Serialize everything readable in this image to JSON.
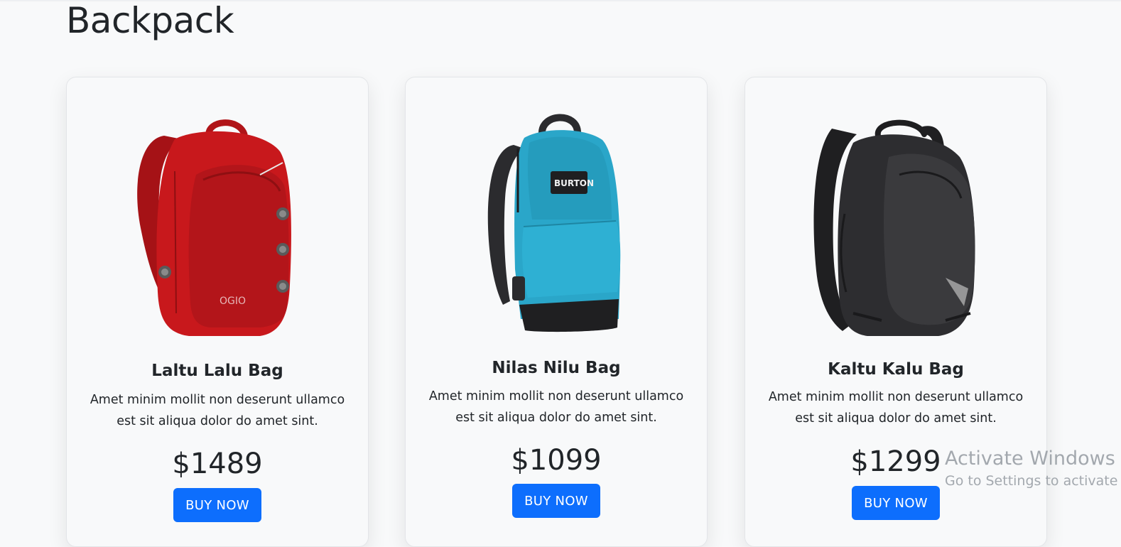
{
  "section": {
    "title": "Backpack"
  },
  "products": [
    {
      "name": "Laltu Lalu Bag",
      "description": "Amet minim mollit non deserunt ullamco est sit aliqua dolor do amet sint.",
      "price": "$1489",
      "button_label": "BUY NOW",
      "image_icon": "red-backpack-image",
      "brand_text": "OGIO",
      "color": "#c0161a"
    },
    {
      "name": "Nilas Nilu Bag",
      "description": "Amet minim mollit non deserunt ullamco est sit aliqua dolor do amet sint.",
      "price": "$1099",
      "button_label": "BUY NOW",
      "image_icon": "blue-backpack-image",
      "brand_text": "BURTON",
      "color": "#2aa6c9"
    },
    {
      "name": "Kaltu Kalu Bag",
      "description": "Amet minim mollit non deserunt ullamco est sit aliqua dolor do amet sint.",
      "price": "$1299",
      "button_label": "BUY NOW",
      "image_icon": "black-backpack-image",
      "color": "#2a2a2c"
    }
  ],
  "watermark": {
    "title": "Activate Windows",
    "subtitle": "Go to Settings to activate"
  },
  "colors": {
    "accent": "#0d6efd",
    "background": "#f8f9fa",
    "text": "#212529"
  }
}
